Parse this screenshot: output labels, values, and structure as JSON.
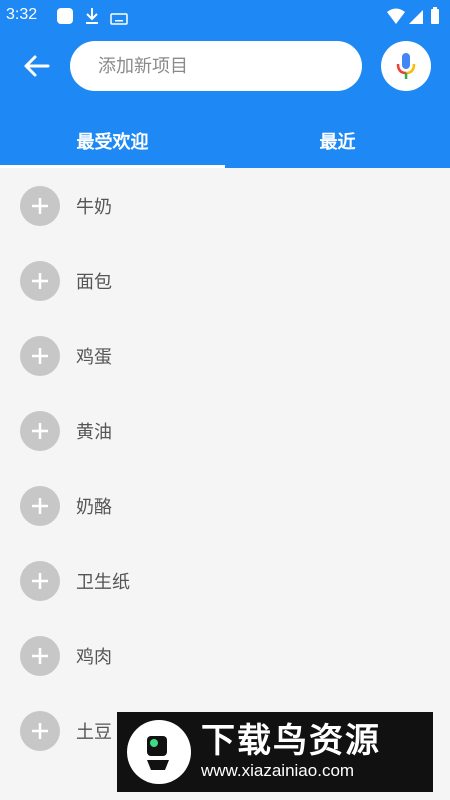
{
  "status_bar": {
    "time": "3:32"
  },
  "header": {
    "search_placeholder": "添加新项目",
    "tabs": [
      {
        "label": "最受欢迎",
        "selected": true
      },
      {
        "label": "最近",
        "selected": false
      }
    ]
  },
  "items": [
    {
      "label": "牛奶"
    },
    {
      "label": "面包"
    },
    {
      "label": "鸡蛋"
    },
    {
      "label": "黄油"
    },
    {
      "label": "奶酪"
    },
    {
      "label": "卫生纸"
    },
    {
      "label": "鸡肉"
    },
    {
      "label": "土豆"
    }
  ],
  "watermark": {
    "title": "下载鸟资源",
    "url": "www.xiazainiao.com"
  },
  "colors": {
    "primary": "#1e88f5",
    "plus_bg": "#c7c7c7",
    "list_bg": "#f5f5f5"
  }
}
